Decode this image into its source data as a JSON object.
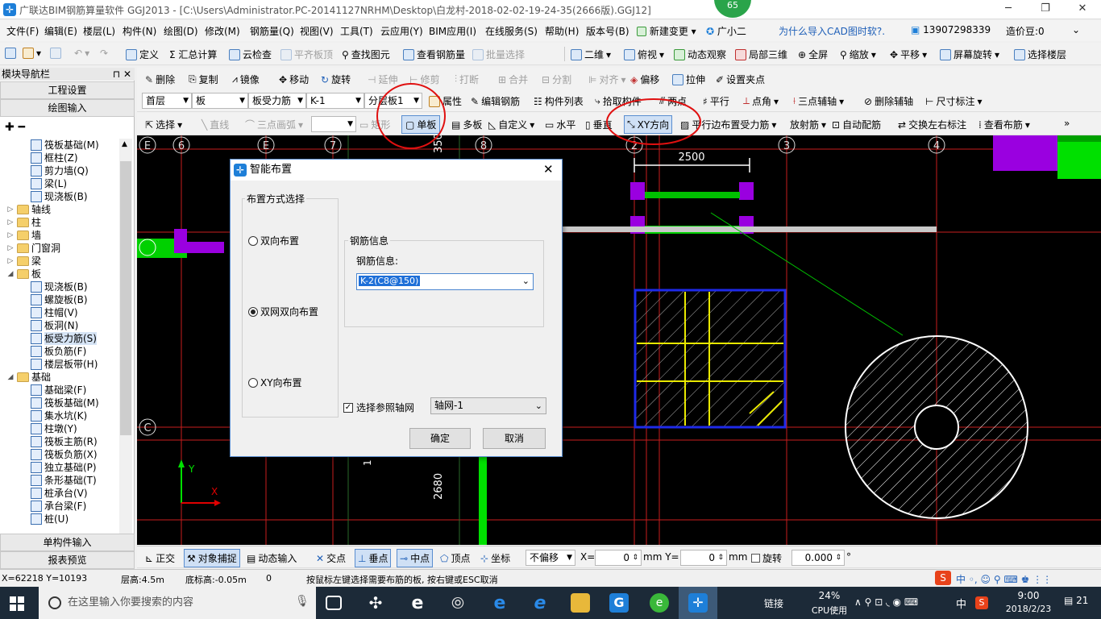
{
  "titlebar": {
    "title": "广联达BIM钢筋算量软件 GGJ2013 - [C:\\Users\\Administrator.PC-20141127NRHM\\Desktop\\白龙村-2018-02-02-19-24-35(2666版).GGJ12]",
    "badge": "65",
    "minimize": "─",
    "restore": "❐",
    "close": "✕"
  },
  "menu": [
    "文件(F)",
    "编辑(E)",
    "楼层(L)",
    "构件(N)",
    "绘图(D)",
    "修改(M)",
    "钢筋量(Q)",
    "视图(V)",
    "工具(T)",
    "云应用(Y)",
    "BIM应用(I)",
    "在线服务(S)",
    "帮助(H)",
    "版本号(B)",
    "新建变更",
    "广小二",
    "为什么导入CAD图时软?.",
    "13907298339",
    "造价豆:0"
  ],
  "toolbar1": {
    "define": "定义",
    "sum": "Σ 汇总计算",
    "cloud_check": "云检查",
    "align_top": "平齐板顶",
    "find": "查找图元",
    "view_rebar": "查看钢筋量",
    "batch": "批量选择",
    "view2d": "二维",
    "top_view": "俯视",
    "dynamic": "动态观察",
    "local3d": "局部三维",
    "fullscreen": "全屏",
    "zoom": "缩放",
    "pan": "平移",
    "rotate_screen": "屏幕旋转",
    "select_floor": "选择楼层"
  },
  "toolbar2": {
    "delete": "删除",
    "copy": "复制",
    "mirror": "镜像",
    "move": "移动",
    "rotate": "旋转",
    "extend": "延伸",
    "trim": "修剪",
    "break": "打断",
    "merge": "合并",
    "split": "分割",
    "align": "对齐",
    "offset": "偏移",
    "stretch": "拉伸",
    "set_point": "设置夹点"
  },
  "toolbar3": {
    "floor": "首层",
    "type": "板",
    "sub_type": "板受力筋",
    "name": "K-1",
    "layer": "分层板1",
    "attr": "属性",
    "edit_rebar": "编辑钢筋",
    "member_list": "构件列表",
    "pick": "拾取构件",
    "two_point": "两点",
    "parallel": "平行",
    "point_angle": "点角",
    "three_point_axis": "三点辅轴",
    "delete_axis": "删除辅轴",
    "dimension": "尺寸标注"
  },
  "toolbar4": {
    "select": "选择",
    "line": "直线",
    "arc": "三点画弧",
    "rect": "矩形",
    "single": "单板",
    "multi": "多板",
    "custom": "自定义",
    "horizontal": "水平",
    "vertical": "垂直",
    "xy": "XY方向",
    "parallel_edge": "平行边布置受力筋",
    "radial": "放射筋",
    "auto": "自动配筋",
    "swap": "交换左右标注",
    "view_layout": "查看布筋"
  },
  "nav": {
    "header": "模块导航栏",
    "pin": "⊓ ✕",
    "project_settings": "工程设置",
    "drawing_input": "绘图输入",
    "single_input": "单构件输入",
    "report_preview": "报表预览",
    "tree": [
      {
        "label": "筏板基础(M)",
        "level": 2,
        "kind": "item"
      },
      {
        "label": "框柱(Z)",
        "level": 2,
        "kind": "item"
      },
      {
        "label": "剪力墙(Q)",
        "level": 2,
        "kind": "item"
      },
      {
        "label": "梁(L)",
        "level": 2,
        "kind": "item"
      },
      {
        "label": "现浇板(B)",
        "level": 2,
        "kind": "item"
      },
      {
        "label": "轴线",
        "level": 1,
        "kind": "folder",
        "exp": "▷"
      },
      {
        "label": "柱",
        "level": 1,
        "kind": "folder",
        "exp": "▷"
      },
      {
        "label": "墙",
        "level": 1,
        "kind": "folder",
        "exp": "▷"
      },
      {
        "label": "门窗洞",
        "level": 1,
        "kind": "folder",
        "exp": "▷"
      },
      {
        "label": "梁",
        "level": 1,
        "kind": "folder",
        "exp": "▷"
      },
      {
        "label": "板",
        "level": 1,
        "kind": "folder",
        "exp": "◢"
      },
      {
        "label": "现浇板(B)",
        "level": 2,
        "kind": "item"
      },
      {
        "label": "螺旋板(B)",
        "level": 2,
        "kind": "item"
      },
      {
        "label": "柱帽(V)",
        "level": 2,
        "kind": "item"
      },
      {
        "label": "板洞(N)",
        "level": 2,
        "kind": "item"
      },
      {
        "label": "板受力筋(S)",
        "level": 2,
        "kind": "item",
        "selected": true
      },
      {
        "label": "板负筋(F)",
        "level": 2,
        "kind": "item"
      },
      {
        "label": "楼层板带(H)",
        "level": 2,
        "kind": "item"
      },
      {
        "label": "基础",
        "level": 1,
        "kind": "folder",
        "exp": "◢"
      },
      {
        "label": "基础梁(F)",
        "level": 2,
        "kind": "item"
      },
      {
        "label": "筏板基础(M)",
        "level": 2,
        "kind": "item"
      },
      {
        "label": "集水坑(K)",
        "level": 2,
        "kind": "item"
      },
      {
        "label": "柱墩(Y)",
        "level": 2,
        "kind": "item"
      },
      {
        "label": "筏板主筋(R)",
        "level": 2,
        "kind": "item"
      },
      {
        "label": "筏板负筋(X)",
        "level": 2,
        "kind": "item"
      },
      {
        "label": "独立基础(P)",
        "level": 2,
        "kind": "item"
      },
      {
        "label": "条形基础(T)",
        "level": 2,
        "kind": "item"
      },
      {
        "label": "桩承台(V)",
        "level": 2,
        "kind": "item"
      },
      {
        "label": "承台梁(F)",
        "level": 2,
        "kind": "item"
      },
      {
        "label": "桩(U)",
        "level": 2,
        "kind": "item"
      }
    ]
  },
  "canvas": {
    "axis_labels": [
      "E",
      "6",
      "E",
      "7",
      "8",
      "2",
      "3",
      "4",
      "C",
      "C"
    ],
    "dim_top": "2500",
    "dim_vertical_1": "2680",
    "dim_vertical_2": "350",
    "dim_vertical_3": "1",
    "ucs_y": "Y",
    "ucs_x": "X"
  },
  "dialog": {
    "title": "智能布置",
    "close": "✕",
    "layout_group": "布置方式选择",
    "options": [
      "双向布置",
      "双网双向布置",
      "XY向布置"
    ],
    "selected_index": 1,
    "rebar_group": "钢筋信息",
    "rebar_label": "钢筋信息:",
    "rebar_value": "K-2(C8@150)",
    "ref_checkbox": "选择参照轴网",
    "ref_value": "轴网-1",
    "ok": "确定",
    "cancel": "取消"
  },
  "snapbar": {
    "ortho": "正交",
    "snap": "对象捕捉",
    "dyn": "动态输入",
    "intersect": "交点",
    "perp": "垂点",
    "mid": "中点",
    "vertex": "顶点",
    "coord": "坐标",
    "no_offset": "不偏移",
    "x_label": "X=",
    "x_value": "0",
    "y_label": "mm Y=",
    "y_value": "0",
    "mm": "mm",
    "rotate": "旋转",
    "rotate_value": "0.000",
    "deg": "°"
  },
  "status": {
    "coords": "X=62218  Y=10193",
    "floor_height": "层高:4.5m",
    "bottom_elev": "底标高:-0.05m",
    "zero": "0",
    "hint": "按鼠标左键选择需要布筋的板, 按右键或ESC取消"
  },
  "taskbar": {
    "search_placeholder": "在这里输入你要搜索的内容",
    "link": "链接",
    "cpu_percent": "24%",
    "cpu_label": "CPU使用",
    "ime": "中",
    "time": "9:00",
    "date": "2018/2/23",
    "notif": "21"
  }
}
